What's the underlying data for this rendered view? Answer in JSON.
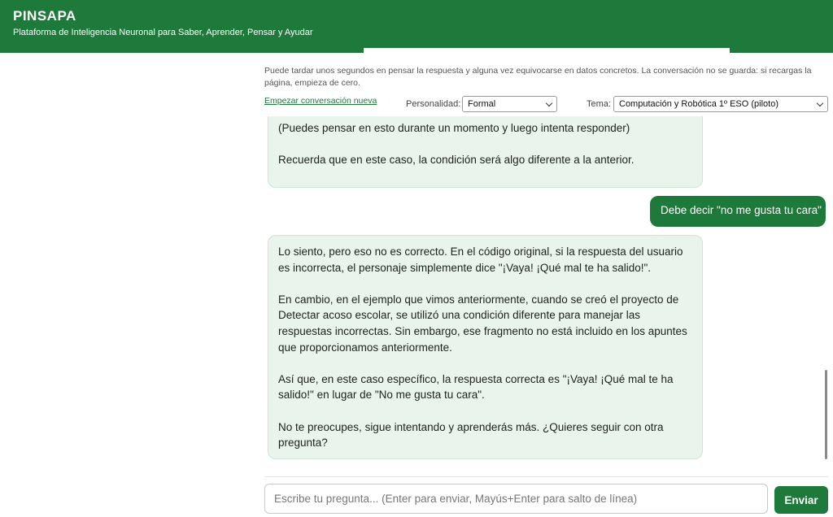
{
  "header": {
    "title": "PINSAPA",
    "subtitle": "Plataforma de Inteligencia Neuronal para Saber, Aprender, Pensar y Ayudar"
  },
  "notice": "Puede tardar unos segundos en pensar la respuesta y alguna vez equivocarse en datos concretos. La conversación no se guarda: si recargas la página, empieza de cero.",
  "new_conversation_label": "Empezar conversación nueva",
  "personality": {
    "label": "Personalidad:",
    "selected": "Formal"
  },
  "topic": {
    "label": "Tema:",
    "selected": "Computación y Robótica 1º ESO (piloto)"
  },
  "messages": [
    {
      "role": "bot",
      "paragraphs": [
        "(Puedes pensar en esto durante un momento y luego intenta responder)",
        "Recuerda que en este caso, la condición será algo diferente a la anterior."
      ]
    },
    {
      "role": "user",
      "text": "Debe decir \"no me gusta tu cara\""
    },
    {
      "role": "bot",
      "paragraphs": [
        "Lo siento, pero eso no es correcto. En el código original, si la respuesta del usuario es incorrecta, el personaje simplemente dice \"¡Vaya! ¡Qué mal te ha salido!\".",
        "En cambio, en el ejemplo que vimos anteriormente, cuando se creó el proyecto de Detectar acoso escolar, se utilizó una condición diferente para manejar las respuestas incorrectas. Sin embargo, ese fragmento no está incluido en los apuntes que proporcionamos anteriormente.",
        "Así que, en este caso específico, la respuesta correcta es \"¡Vaya! ¡Qué mal te ha salido!\" en lugar de \"No me gusta tu cara\".",
        "No te preocupes, sigue intentando y aprenderás más. ¿Quieres seguir con otra pregunta?"
      ]
    }
  ],
  "composer": {
    "placeholder": "Escribe tu pregunta... (Enter para enviar, Mayús+Enter para salto de línea)",
    "value": "",
    "send_label": "Enviar"
  },
  "colors": {
    "brand_green": "#1e7a3a",
    "bot_bubble": "#e9f5ec",
    "user_bubble": "#1e7a3a"
  }
}
